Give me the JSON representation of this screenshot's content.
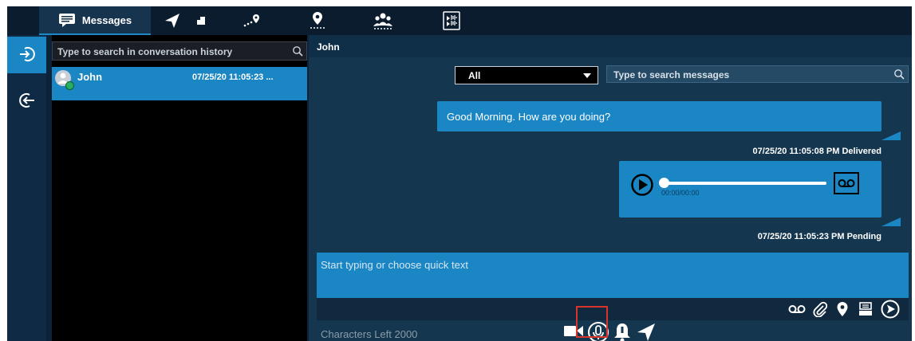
{
  "tabs": {
    "messages_label": "Messages",
    "icons": [
      "messages-icon",
      "navigate-icon",
      "map-icon",
      "route-icon",
      "location-user-icon",
      "group-icon",
      "media-icon"
    ]
  },
  "rail": {
    "items": [
      {
        "name": "inbox-icon",
        "active": true
      },
      {
        "name": "outbox-icon",
        "active": false
      }
    ]
  },
  "conversation_list": {
    "search_placeholder": "Type to search in conversation history",
    "items": [
      {
        "name": "John",
        "timestamp": "07/25/20 11:05:23 ...",
        "selected": true
      }
    ]
  },
  "chat": {
    "contact_name": "John",
    "filter": {
      "selected": "All"
    },
    "search_placeholder": "Type to search messages",
    "messages": [
      {
        "type": "text",
        "text": "Good Morning. How are you doing?",
        "status": "07/25/20 11:05:08 PM Delivered"
      },
      {
        "type": "audio",
        "time": "00:00/00:00",
        "status": "07/25/20 11:05:23 PM Pending"
      }
    ],
    "compose_placeholder": "Start typing or choose quick text",
    "characters_left": "Characters Left 2000"
  },
  "colors": {
    "background": "#0b2238",
    "accent": "#1a86c4",
    "highlight": "#d9342b"
  }
}
